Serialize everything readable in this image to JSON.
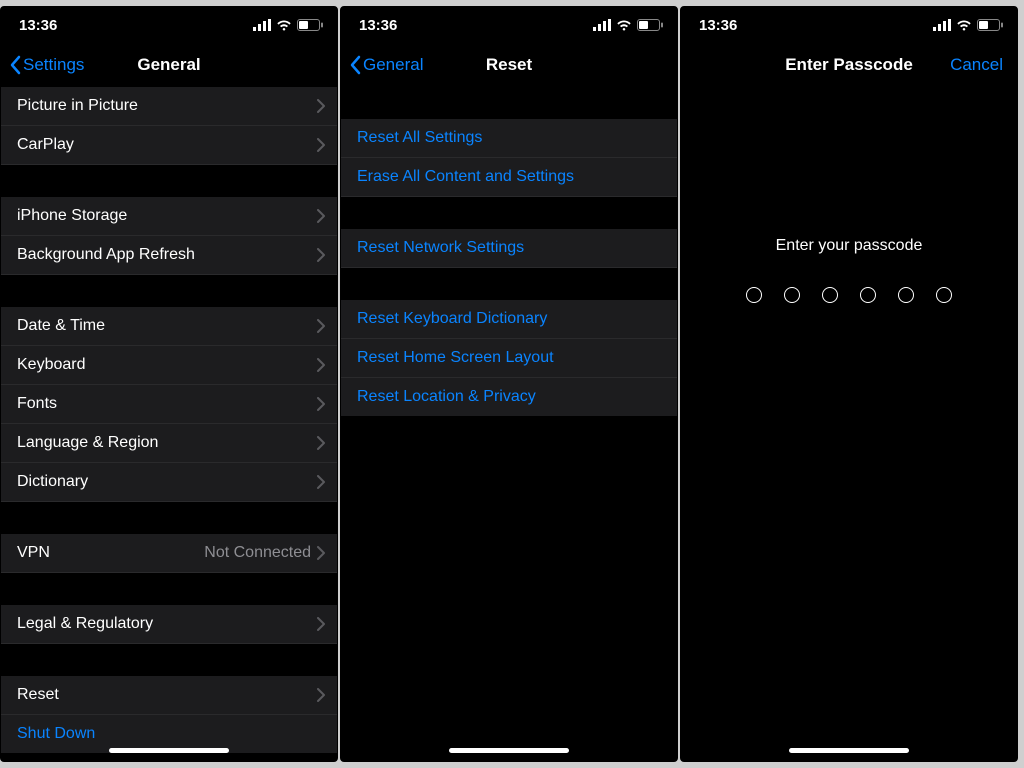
{
  "status": {
    "time": "13:36"
  },
  "general": {
    "back_label": "Settings",
    "title": "General",
    "rows": {
      "picture_in_picture": "Picture in Picture",
      "carplay": "CarPlay",
      "iphone_storage": "iPhone Storage",
      "background_app_refresh": "Background App Refresh",
      "date_time": "Date & Time",
      "keyboard": "Keyboard",
      "fonts": "Fonts",
      "language_region": "Language & Region",
      "dictionary": "Dictionary",
      "vpn": "VPN",
      "vpn_value": "Not Connected",
      "legal": "Legal & Regulatory",
      "reset": "Reset",
      "shut_down": "Shut Down"
    }
  },
  "reset": {
    "back_label": "General",
    "title": "Reset",
    "rows": {
      "reset_all": "Reset All Settings",
      "erase_all": "Erase All Content and Settings",
      "reset_network": "Reset Network Settings",
      "reset_keyboard": "Reset Keyboard Dictionary",
      "reset_home": "Reset Home Screen Layout",
      "reset_location": "Reset Location & Privacy"
    }
  },
  "passcode": {
    "title": "Enter Passcode",
    "cancel": "Cancel",
    "hint": "Enter your passcode",
    "length": 6
  }
}
